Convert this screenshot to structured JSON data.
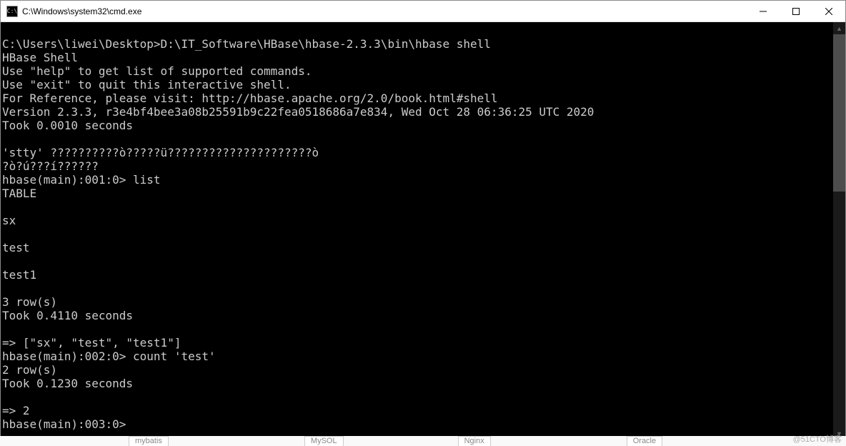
{
  "window": {
    "icon_text": "C:\\",
    "title": "C:\\Windows\\system32\\cmd.exe"
  },
  "terminal": {
    "lines": [
      "",
      "C:\\Users\\liwei\\Desktop>D:\\IT_Software\\HBase\\hbase-2.3.3\\bin\\hbase shell",
      "HBase Shell",
      "Use \"help\" to get list of supported commands.",
      "Use \"exit\" to quit this interactive shell.",
      "For Reference, please visit: http://hbase.apache.org/2.0/book.html#shell",
      "Version 2.3.3, r3e4bf4bee3a08b25591b9c22fea0518686a7e834, Wed Oct 28 06:36:25 UTC 2020",
      "Took 0.0010 seconds",
      "",
      "'stty' ??????????ò?????ü?????????????????????ò",
      "?ò?ú???í??????",
      "hbase(main):001:0> list",
      "TABLE",
      "",
      "sx",
      "",
      "test",
      "",
      "test1",
      "",
      "3 row(s)",
      "Took 0.4110 seconds",
      "",
      "=> [\"sx\", \"test\", \"test1\"]",
      "hbase(main):002:0> count 'test'",
      "2 row(s)",
      "Took 0.1230 seconds",
      "",
      "=> 2",
      "hbase(main):003:0>"
    ]
  },
  "bottom_tabs": [
    "mybatis",
    "MySOL",
    "Nginx",
    "Oracle"
  ],
  "watermark": "@51CTO博客"
}
